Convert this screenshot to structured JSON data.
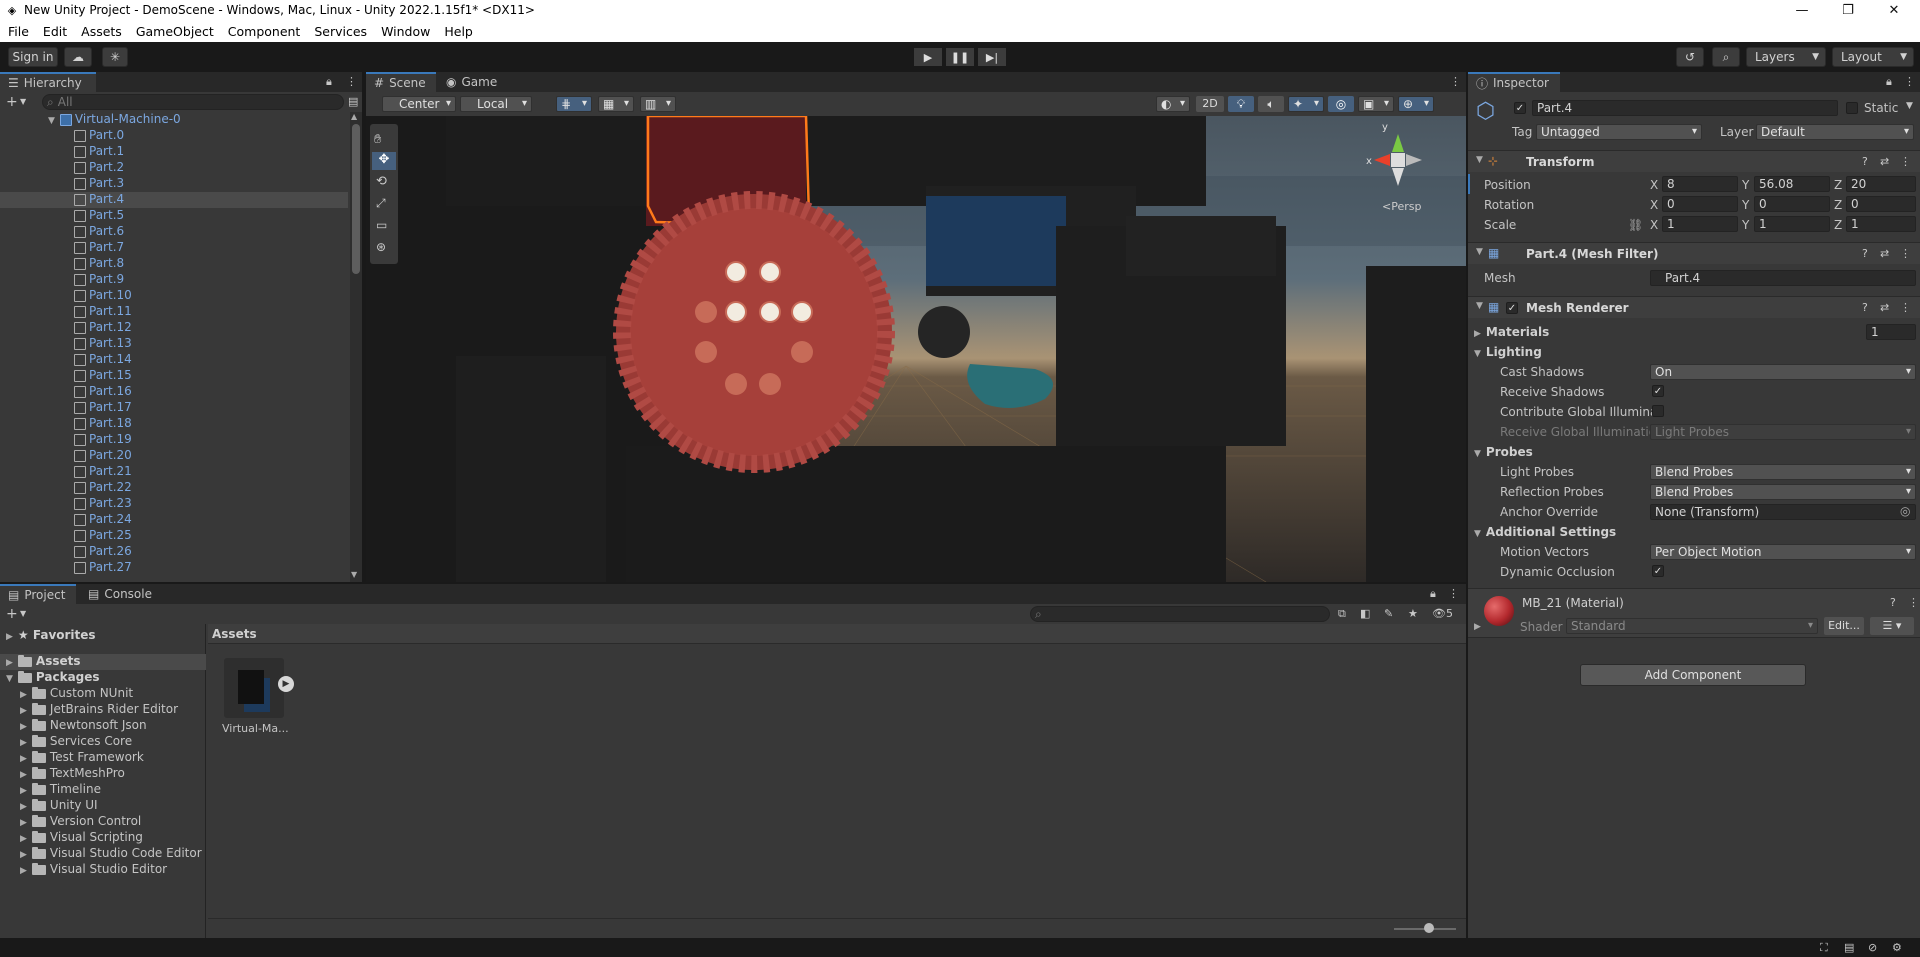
{
  "window": {
    "title": "New Unity Project - DemoScene - Windows, Mac, Linux - Unity 2022.1.15f1* <DX11>"
  },
  "menu": [
    "File",
    "Edit",
    "Assets",
    "GameObject",
    "Component",
    "Services",
    "Window",
    "Help"
  ],
  "toolbar": {
    "sign_in": "Sign in",
    "layers": "Layers",
    "layout": "Layout"
  },
  "hierarchy": {
    "tab": "Hierarchy",
    "search_placeholder": "All",
    "root": "Virtual-Machine-0",
    "items": [
      "Part.0",
      "Part.1",
      "Part.2",
      "Part.3",
      "Part.4",
      "Part.5",
      "Part.6",
      "Part.7",
      "Part.8",
      "Part.9",
      "Part.10",
      "Part.11",
      "Part.12",
      "Part.13",
      "Part.14",
      "Part.15",
      "Part.16",
      "Part.17",
      "Part.18",
      "Part.19",
      "Part.20",
      "Part.21",
      "Part.22",
      "Part.23",
      "Part.24",
      "Part.25",
      "Part.26",
      "Part.27"
    ],
    "selected": "Part.4"
  },
  "scene": {
    "tabs": [
      "Scene",
      "Game"
    ],
    "pivot": "Center",
    "space": "Local",
    "mode_2d": "2D",
    "persp": "Persp"
  },
  "inspector": {
    "tab": "Inspector",
    "object_name": "Part.4",
    "static_label": "Static",
    "tag_label": "Tag",
    "tag_value": "Untagged",
    "layer_label": "Layer",
    "layer_value": "Default",
    "transform": {
      "title": "Transform",
      "position_label": "Position",
      "rotation_label": "Rotation",
      "scale_label": "Scale",
      "position": {
        "x": "8",
        "y": "56.08",
        "z": "20"
      },
      "rotation": {
        "x": "0",
        "y": "0",
        "z": "0"
      },
      "scale": {
        "x": "1",
        "y": "1",
        "z": "1"
      },
      "axis": {
        "x": "X",
        "y": "Y",
        "z": "Z"
      }
    },
    "mesh_filter": {
      "title": "Part.4 (Mesh Filter)",
      "mesh_label": "Mesh",
      "mesh_value": "Part.4"
    },
    "mesh_renderer": {
      "title": "Mesh Renderer",
      "materials_label": "Materials",
      "materials_count": "1",
      "lighting": "Lighting",
      "cast_shadows_label": "Cast Shadows",
      "cast_shadows_value": "On",
      "receive_shadows_label": "Receive Shadows",
      "contribute_gi_label": "Contribute Global Illuminat",
      "receive_gi_label": "Receive Global Illuminatior",
      "receive_gi_value": "Light Probes",
      "probes": "Probes",
      "light_probes_label": "Light Probes",
      "light_probes_value": "Blend Probes",
      "reflection_probes_label": "Reflection Probes",
      "reflection_probes_value": "Blend Probes",
      "anchor_override_label": "Anchor Override",
      "anchor_override_value": "None (Transform)",
      "additional": "Additional Settings",
      "motion_vectors_label": "Motion Vectors",
      "motion_vectors_value": "Per Object Motion",
      "dynamic_occlusion_label": "Dynamic Occlusion"
    },
    "material": {
      "name": "MB_21 (Material)",
      "shader_label": "Shader",
      "shader_value": "Standard",
      "edit": "Edit...",
      "color": "#b3282d"
    },
    "add_component": "Add Component"
  },
  "project": {
    "tabs": [
      "Project",
      "Console"
    ],
    "favorites": "Favorites",
    "assets": "Assets",
    "packages": "Packages",
    "package_items": [
      "Custom NUnit",
      "JetBrains Rider Editor",
      "Newtonsoft Json",
      "Services Core",
      "Test Framework",
      "TextMeshPro",
      "Timeline",
      "Unity UI",
      "Version Control",
      "Visual Scripting",
      "Visual Studio Code Editor",
      "Visual Studio Editor"
    ],
    "breadcrumb": "Assets",
    "asset_items": [
      "Virtual-Ma..."
    ],
    "hidden_count": "5"
  },
  "colors": {
    "accent": "#3a79bb",
    "panel": "#383838",
    "gear_red": "#a6403a"
  }
}
